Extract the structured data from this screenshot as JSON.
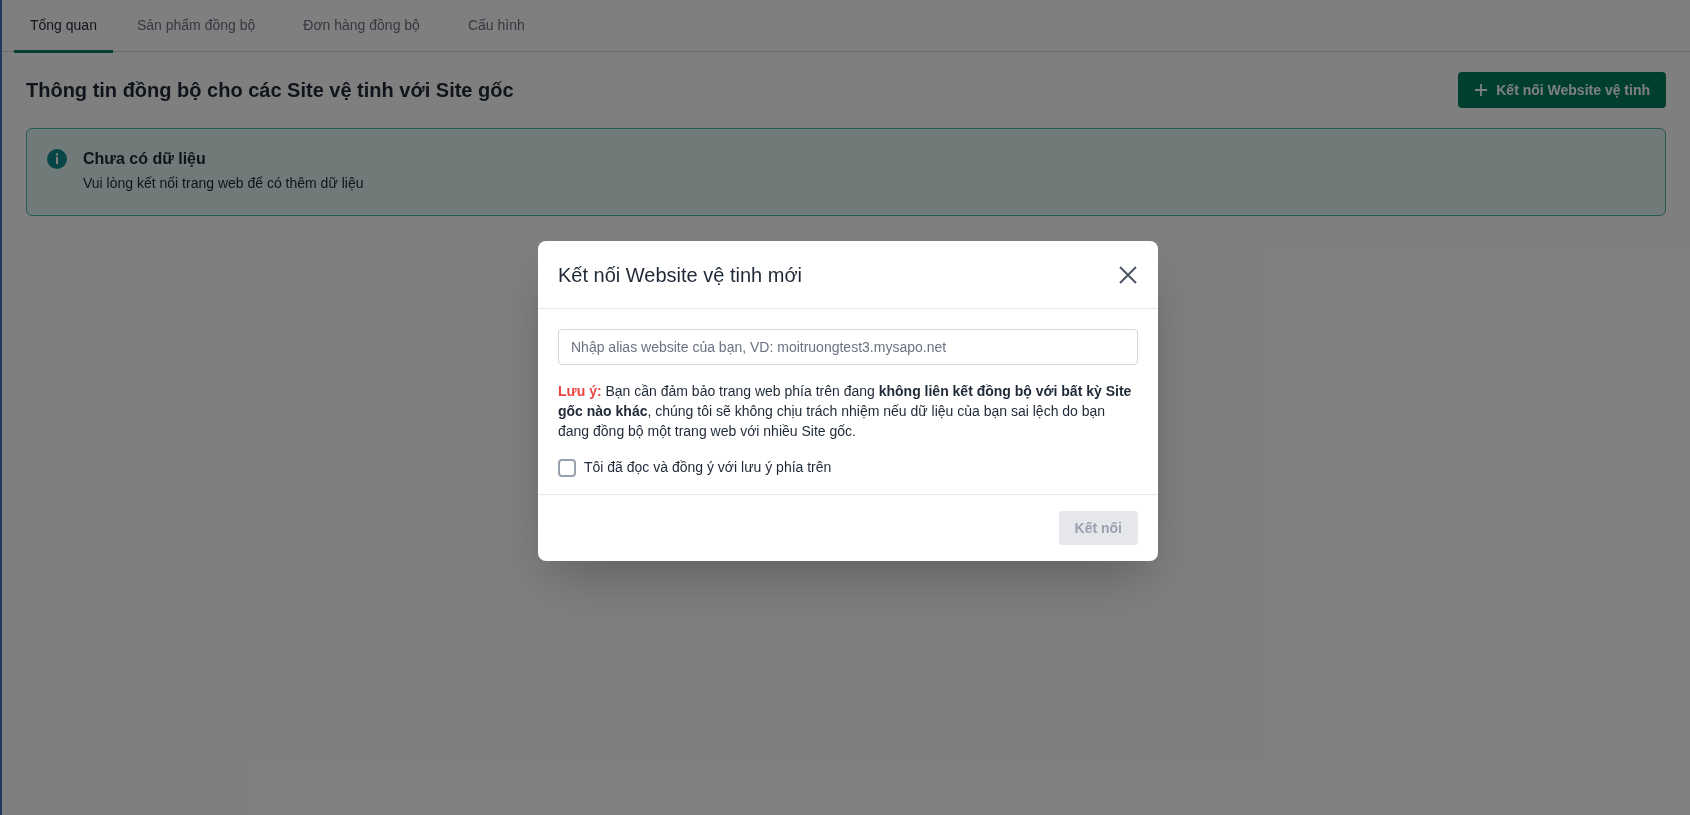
{
  "tabs": [
    {
      "label": "Tổng quan",
      "selected": true
    },
    {
      "label": "Sản phẩm đồng bộ",
      "selected": false
    },
    {
      "label": "Đơn hàng đồng bộ",
      "selected": false
    },
    {
      "label": "Cấu hình",
      "selected": false
    }
  ],
  "page_title": "Thông tin đồng bộ cho các Site vệ tinh với Site gốc",
  "primary_button": "Kết nối Website vệ tinh",
  "alert": {
    "title": "Chưa có dữ liệu",
    "message": "Vui lòng kết nối trang web để có thêm dữ liệu"
  },
  "modal": {
    "title": "Kết nối Website vệ tinh mới",
    "input": {
      "placeholder": "Nhập alias website của bạn, VD: moitruongtest3.mysapo.net"
    },
    "note_label": "Lưu ý:",
    "note_text": "Bạn cần đảm bảo trang web phía trên đang **không liên kết đồng bộ với bất kỳ Site gốc nào khác**, chúng tôi sẽ không chịu trách nhiệm nếu dữ liệu của bạn sai lệch do bạn đang đồng bộ một trang web với nhiều Site gốc.",
    "checkbox": {
      "label": "Tôi đã đọc và đồng ý với lưu ý phía trên",
      "checked": false
    },
    "submit": {
      "label": "Kết nối",
      "disabled": true
    }
  }
}
